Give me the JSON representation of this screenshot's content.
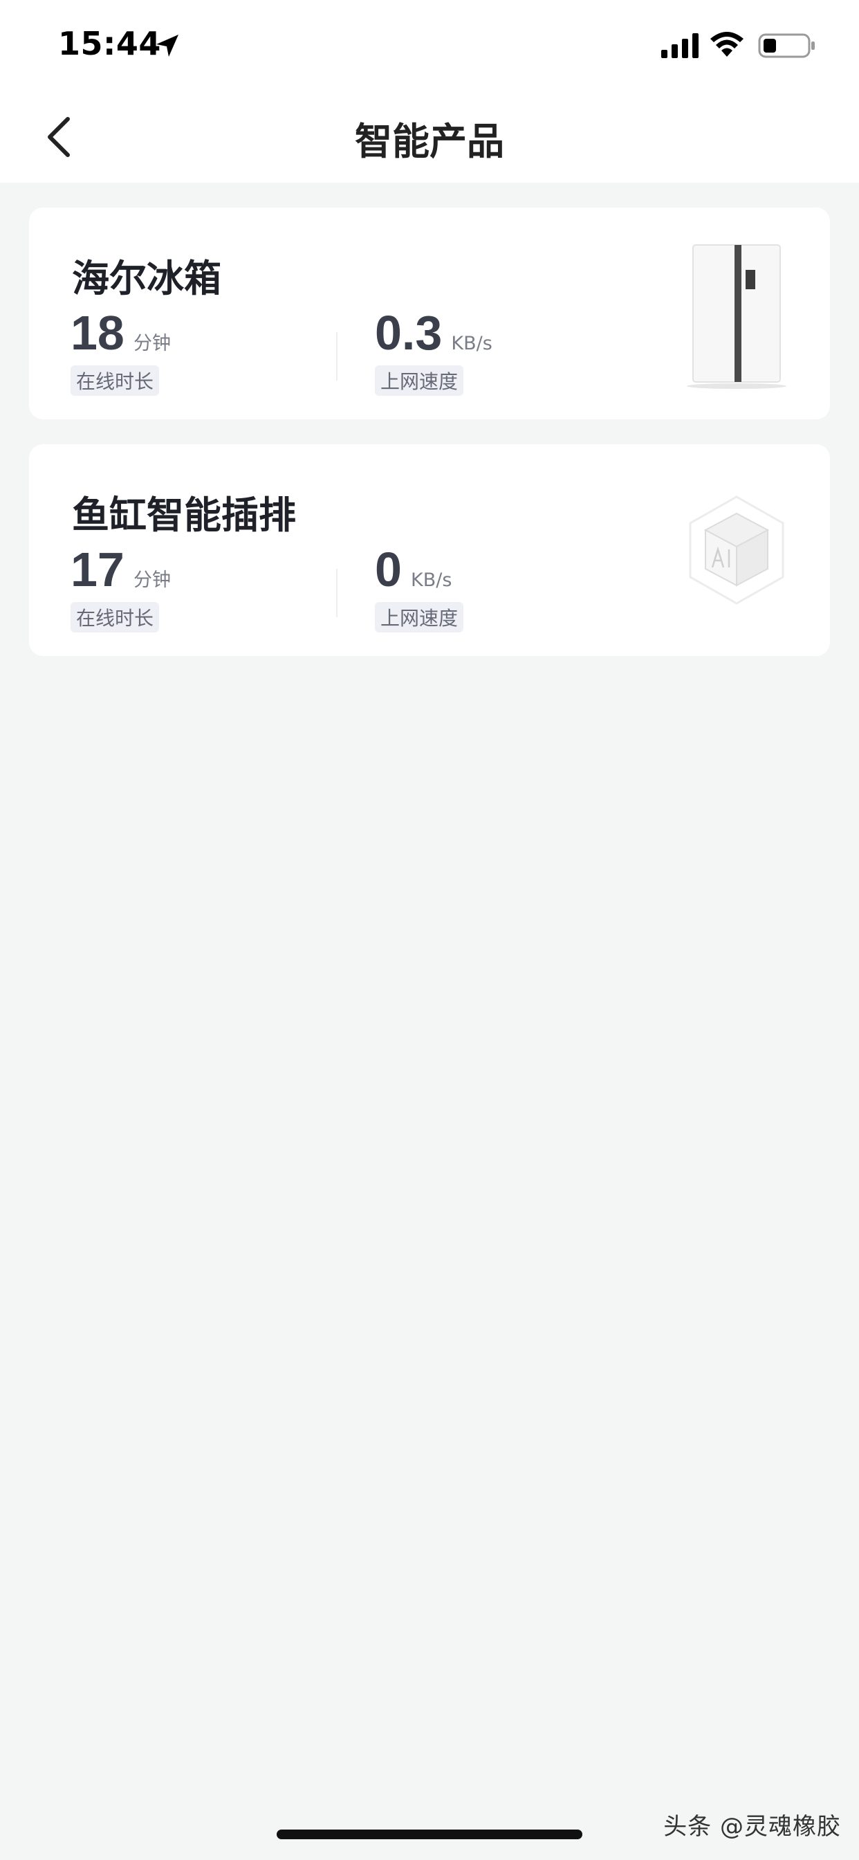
{
  "status_bar": {
    "time": "15:44"
  },
  "header": {
    "title": "智能产品"
  },
  "devices": [
    {
      "name": "海尔冰箱",
      "online_value": "18",
      "online_unit": "分钟",
      "online_label": "在线时长",
      "speed_value": "0.3",
      "speed_unit": "KB/s",
      "speed_label": "上网速度",
      "icon": "refrigerator-icon"
    },
    {
      "name": "鱼缸智能插排",
      "online_value": "17",
      "online_unit": "分钟",
      "online_label": "在线时长",
      "speed_value": "0",
      "speed_unit": "KB/s",
      "speed_label": "上网速度",
      "icon": "ai-cube-icon"
    }
  ],
  "watermark": "头条 @灵魂橡胶"
}
